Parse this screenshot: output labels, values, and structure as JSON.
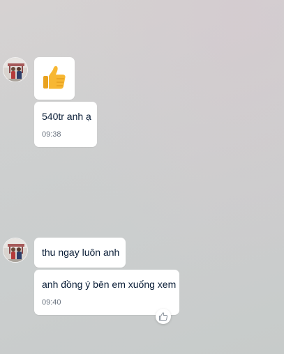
{
  "conversation": {
    "groups": [
      {
        "sender_avatar": "avatar-photo",
        "messages": [
          {
            "type": "sticker",
            "icon": "thumbs-up-icon"
          },
          {
            "type": "text",
            "text": "540tr anh ạ",
            "time": "09:38"
          }
        ]
      },
      {
        "sender_avatar": "avatar-photo",
        "messages": [
          {
            "type": "text",
            "text": "thu ngay luôn anh"
          },
          {
            "type": "text",
            "text": "anh đồng ý bên em xuống xem",
            "time": "09:40",
            "reaction_button": "like-icon"
          }
        ]
      }
    ]
  },
  "colors": {
    "bubble_bg": "#ffffff",
    "text": "#081c36",
    "time_text": "#6b7480",
    "thumb_yellow": "#f7b733"
  }
}
